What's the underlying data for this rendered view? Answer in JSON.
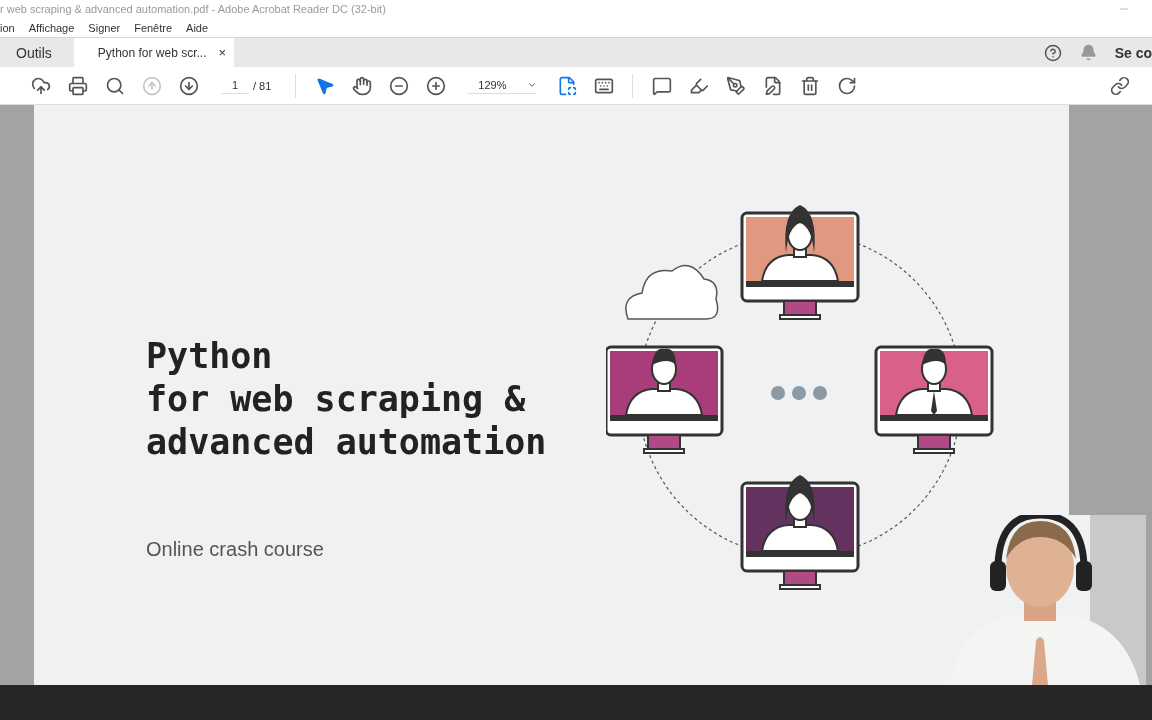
{
  "window": {
    "title": "r web scraping & advanced automation.pdf - Adobe Acrobat Reader DC (32-bit)"
  },
  "menu": [
    "ion",
    "Affichage",
    "Signer",
    "Fenêtre",
    "Aide"
  ],
  "tabs": [
    {
      "label": "Outils",
      "selected": false,
      "closable": false
    },
    {
      "label": "Python for web scr...",
      "selected": true,
      "closable": true,
      "close": "×"
    }
  ],
  "account": {
    "label": "Se co"
  },
  "toolbar": {
    "nav": [
      {
        "kind": "up",
        "disabled": true
      },
      {
        "kind": "down",
        "disabled": false
      }
    ],
    "page": "1",
    "page_count": "/ 81",
    "tools": [
      {
        "kind": "select",
        "selected": true
      },
      {
        "kind": "hand",
        "selected": false
      }
    ],
    "zoom": "129%"
  },
  "slide": {
    "title_lines": [
      "Python",
      "for web scraping &",
      "advanced automation"
    ],
    "subtitle": "Online crash course"
  }
}
